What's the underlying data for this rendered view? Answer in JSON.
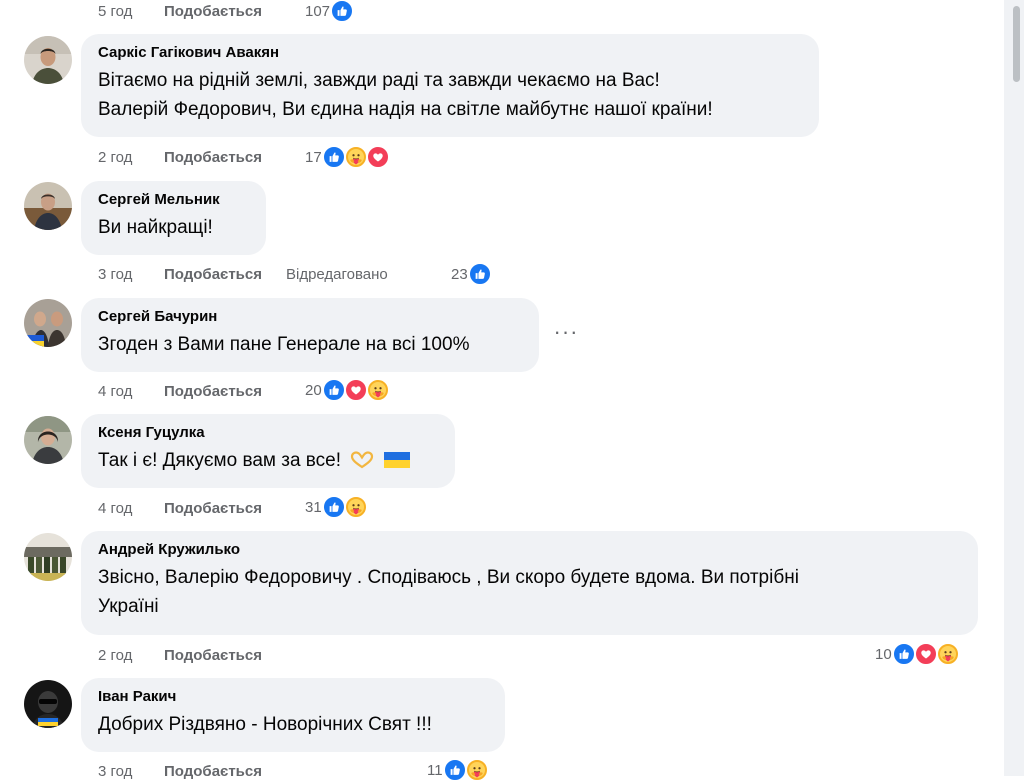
{
  "scrollbar": {},
  "top_meta": {
    "time": "5 год",
    "like_label": "Подобається",
    "reaction_count": "107"
  },
  "comments": [
    {
      "author": "Саркіс Гагікович Авакян",
      "text_line1": "Вітаємо на рідній землі, завжди раді та завжди чекаємо на Вас!",
      "text_line2": "Валерій Федорович, Ви єдина надія на світле майбутнє нашої країни!",
      "time": "2 год",
      "like_label": "Подобається",
      "reaction_count": "17",
      "reactions": [
        "like-icon",
        "care-icon",
        "love-icon"
      ]
    },
    {
      "author": "Сергей Мельник",
      "text": "Ви найкращі!",
      "time": "3 год",
      "like_label": "Подобається",
      "edited_label": "Відредаговано",
      "reaction_count": "23",
      "reactions": [
        "like-icon"
      ]
    },
    {
      "author": "Сергей Бачурин",
      "text": "Згоден з Вами пане Генерале на всі 100%",
      "time": "4 год",
      "like_label": "Подобається",
      "reaction_count": "20",
      "reactions": [
        "like-icon",
        "love-icon",
        "care-icon"
      ],
      "more_label": "···"
    },
    {
      "author": "Ксеня Гуцулка",
      "text": "Так і є! Дякуємо вам за все!",
      "emojis": [
        "heart-hands-icon",
        "ukraine-flag-icon"
      ],
      "time": "4 год",
      "like_label": "Подобається",
      "reaction_count": "31",
      "reactions": [
        "like-icon",
        "care-icon"
      ]
    },
    {
      "author": "Андрей Кружилько",
      "text_line1": "Звісно, Валерію Федоровичу . Сподіваюсь , Ви скоро будете вдома. Ви потрібні",
      "text_line2": "Україні",
      "time": "2 год",
      "like_label": "Подобається",
      "reaction_count": "10",
      "reactions": [
        "like-icon",
        "love-icon",
        "care-icon"
      ]
    },
    {
      "author": "Іван Ракич",
      "text": "Добрих Різдвяно - Новорічних Свят !!!",
      "time": "3 год",
      "like_label": "Подобається",
      "reaction_count": "11",
      "reactions": [
        "like-icon",
        "care-icon"
      ]
    }
  ],
  "colors": {
    "bubble": "#f0f2f5",
    "meta_text": "#65676b",
    "like_blue": "#1877f2",
    "love_red": "#f33e58",
    "care_yellow": "#f7b125"
  }
}
